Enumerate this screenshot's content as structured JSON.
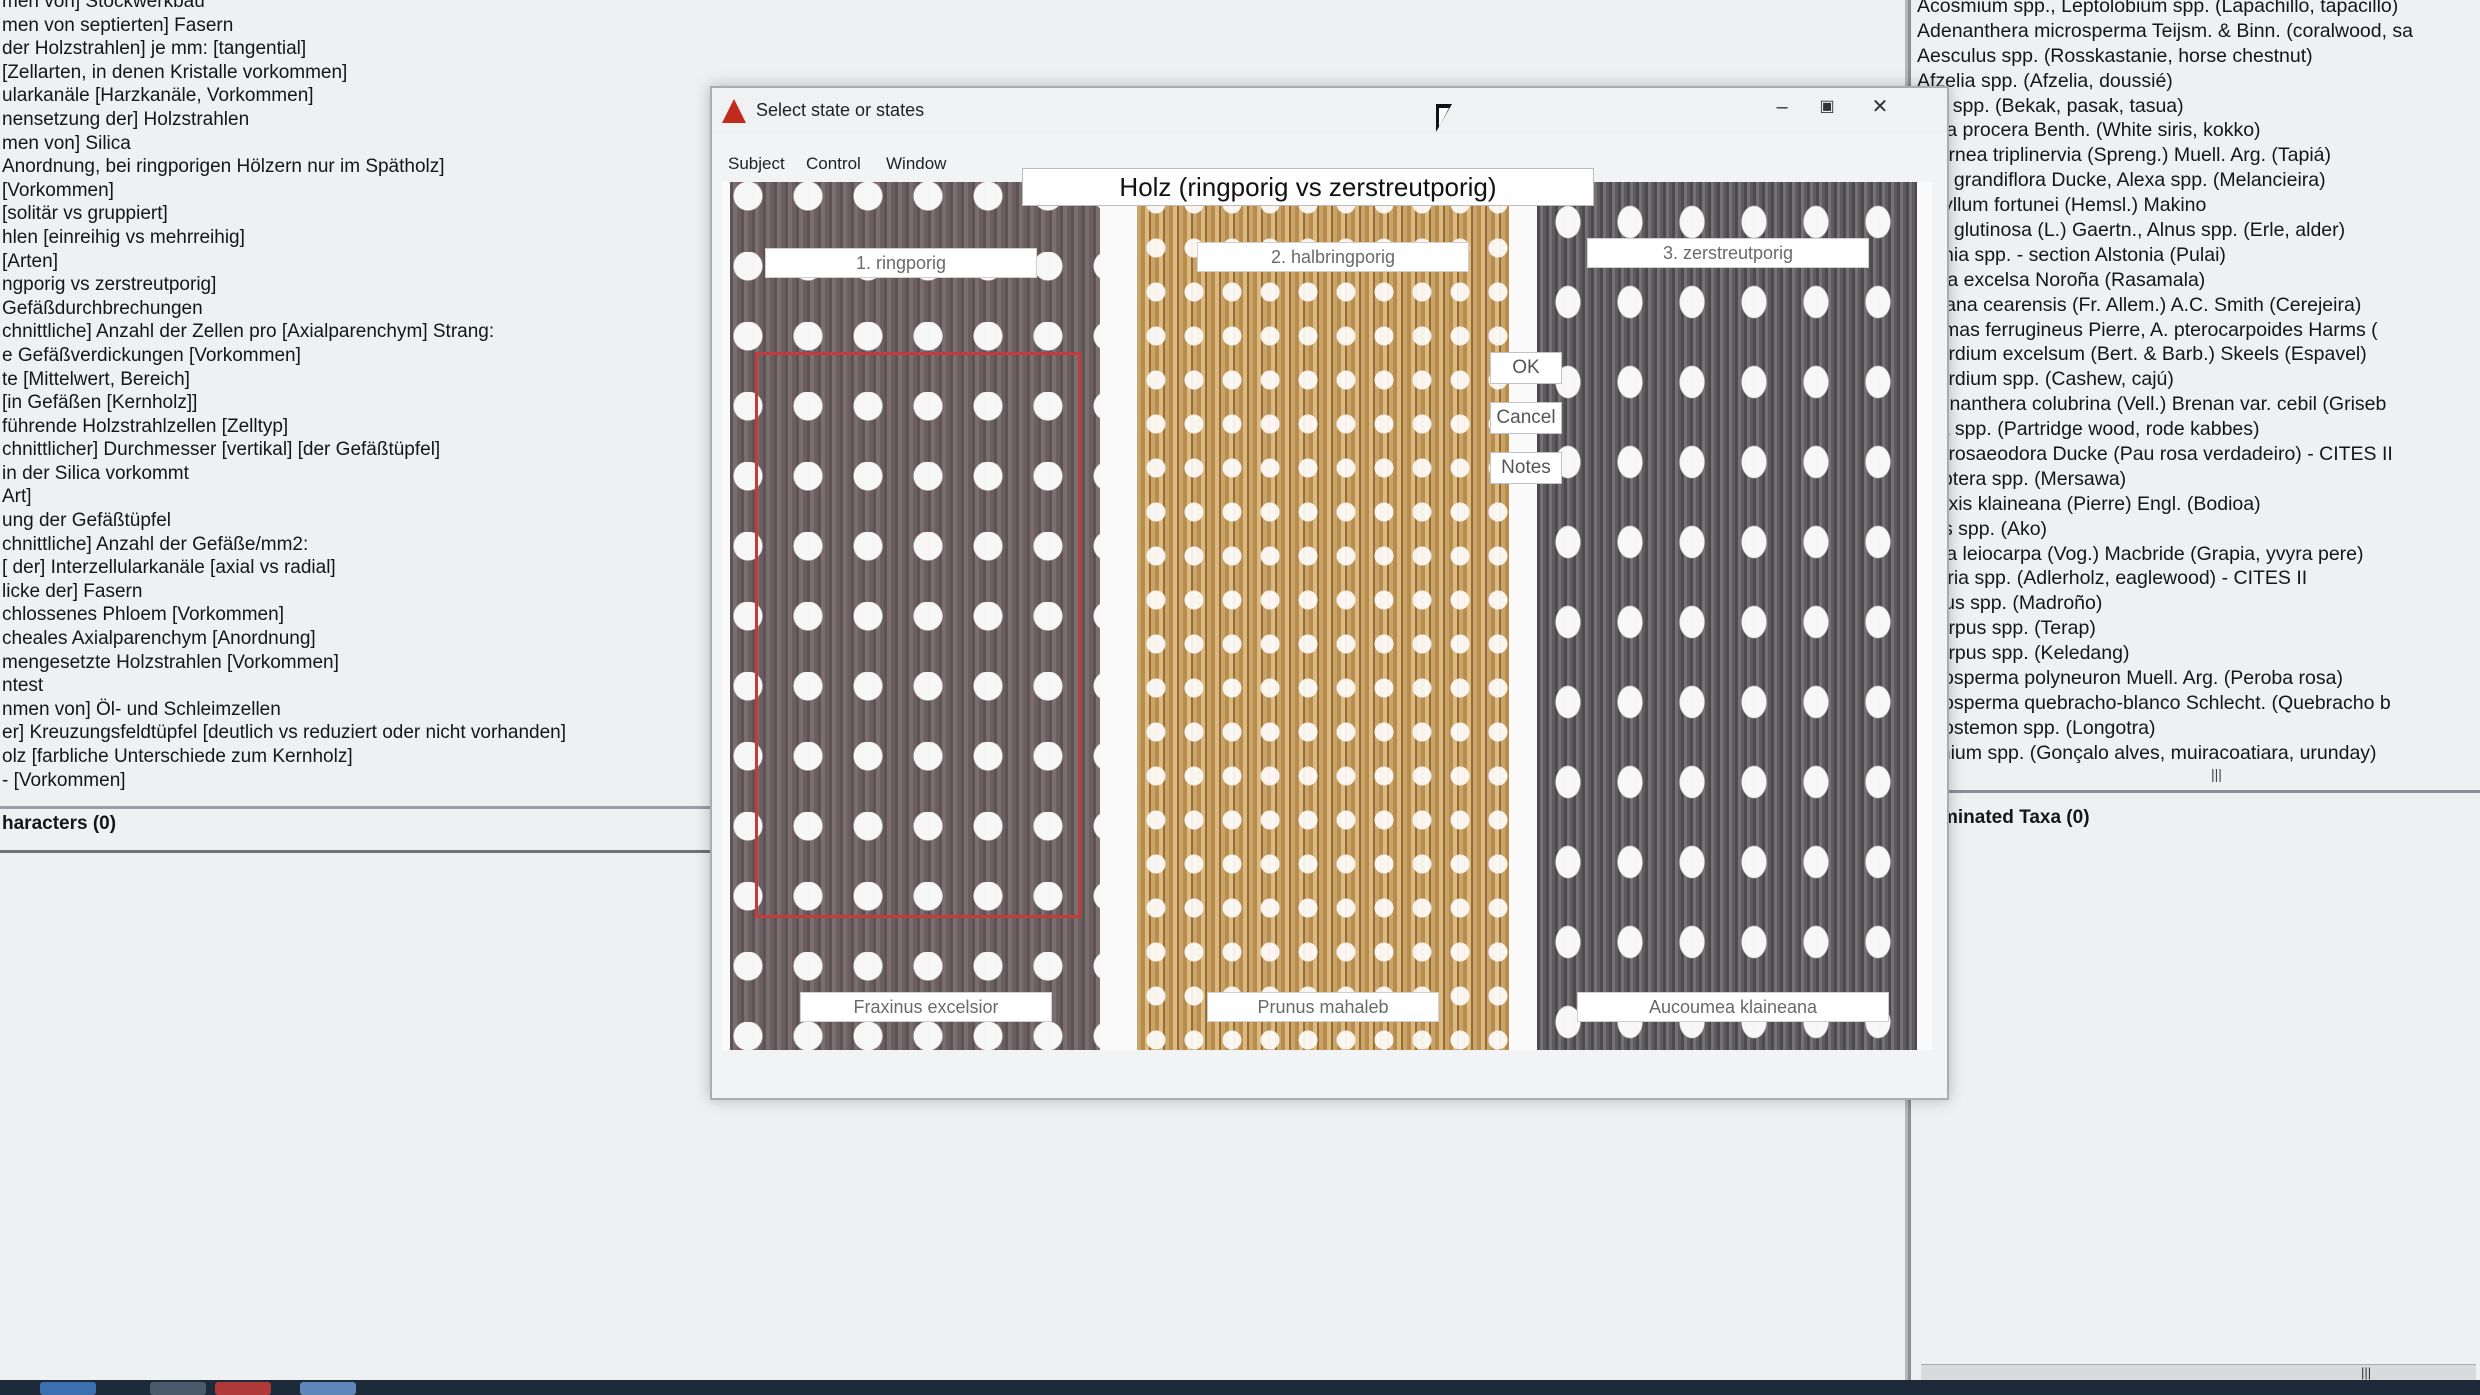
{
  "left_panel": {
    "items": [
      "men von] Stockwerkbau",
      "men von septierten] Fasern",
      "der Holzstrahlen] je mm: [tangential]",
      "[Zellarten, in denen Kristalle vorkommen]",
      "ularkanäle [Harzkanäle, Vorkommen]",
      "nensetzung der] Holzstrahlen",
      "men von] Silica",
      "Anordnung, bei ringporigen Hölzern nur im Spätholz]",
      "[Vorkommen]",
      "[solitär vs gruppiert]",
      "hlen [einreihig vs mehrreihig]",
      "[Arten]",
      "ngporig vs zerstreutporig]",
      "Gefäßdurchbrechungen",
      "chnittliche] Anzahl der Zellen pro [Axialparenchym] Strang:",
      "e Gefäßverdickungen [Vorkommen]",
      "te [Mittelwert, Bereich]",
      "[in Gefäßen [Kernholz]]",
      "führende Holzstrahlzellen [Zelltyp]",
      "chnittlicher] Durchmesser [vertikal] [der Gefäßtüpfel]",
      "in der Silica vorkommt",
      "Art]",
      "ung der Gefäßtüpfel",
      "chnittliche] Anzahl der Gefäße/mm2:",
      "[ der] Interzellularkanäle [axial vs radial]",
      "licke der] Fasern",
      "chlossenes Phloem [Vorkommen]",
      "cheales Axialparenchym [Anordnung]",
      "mengesetzte Holzstrahlen [Vorkommen]",
      "ntest",
      "nmen von] Öl- und Schleimzellen",
      "er] Kreuzungsfeldtüpfel [deutlich vs reduziert oder nicht vorhanden]",
      "olz [farbliche Unterschiede zum Kernholz]",
      "- [Vorkommen]"
    ],
    "status": "haracters (0)"
  },
  "right_panel": {
    "items": [
      "Acosmium spp., Leptolobium spp. (Lapachillo, tapacillo)",
      "Adenanthera microsperma Teijsm. & Binn. (coralwood, sa",
      "Aesculus spp. (Rosskastanie, horse chestnut)",
      "Afzelia spp. (Afzelia, doussié)",
      "laia spp. (Bekak, pasak, tasua)",
      "bizia procera Benth. (White siris, kokko)",
      "chornea triplinervia (Spreng.) Muell. Arg. (Tapiá)",
      "exa grandiflora Ducke, Alexa spp. (Melancieira)",
      "iphyllum fortunei (Hemsl.) Makino",
      "nus glutinosa (L.) Gaertn., Alnus spp. (Erle, alder)",
      "stonia spp. - section Alstonia (Pulai)",
      "ingia excelsa Noroña (Rasamala)",
      "burana cearensis (Fr. Allem.) A.C. Smith (Cerejeira)",
      "phimas ferrugineus Pierre, A. pterocarpoides Harms (",
      "acardium excelsum (Bert. & Barb.) Skeels (Espavel)",
      "acardium spp. (Cashew, cajú)",
      "adenanthera colubrina (Vell.) Brenan var. cebil (Griseb",
      "dira spp. (Partridge wood, rode kabbes)",
      "iba rosaeodora Ducke (Pau rosa verdadeiro) - CITES II",
      "isoptera spp. (Mersawa)",
      "opyxis klaineana (Pierre) Engl. (Bodioa)",
      "laris spp. (Ako)",
      "ulcia leiocarpa (Vog.) Macbride (Grapia, yvyra pere)",
      "uilaria spp. (Adlerholz, eaglewood) - CITES II",
      "butus spp. (Madroño)",
      "ocarpus spp. (Terap)",
      "ocarpus spp. (Keledang)",
      "pidosperma polyneuron Muell. Arg. (Peroba rosa)",
      "pidosperma quebracho-blanco Schlecht. (Quebracho b",
      "pidostemon spp. (Longotra)",
      "tronium spp. (Gonçalo alves, muiracoatiara, urunday)"
    ],
    "status": "minated Taxa (0)"
  },
  "dialog": {
    "title": "Select state or states",
    "menu": [
      "Subject",
      "Control",
      "Window"
    ],
    "heading": "Holz (ringporig vs zerstreutporig)",
    "states": [
      {
        "label": "1. ringporig",
        "species": "Fraxinus excelsior"
      },
      {
        "label": "2. halbringporig",
        "species": "Prunus mahaleb"
      },
      {
        "label": "3. zerstreutporig",
        "species": "Aucoumea klaineana"
      }
    ],
    "buttons": {
      "ok": "OK",
      "cancel": "Cancel",
      "notes": "Notes"
    }
  },
  "colors": {
    "selection": "#c53b3b",
    "title_icon": "#c12a1e"
  }
}
